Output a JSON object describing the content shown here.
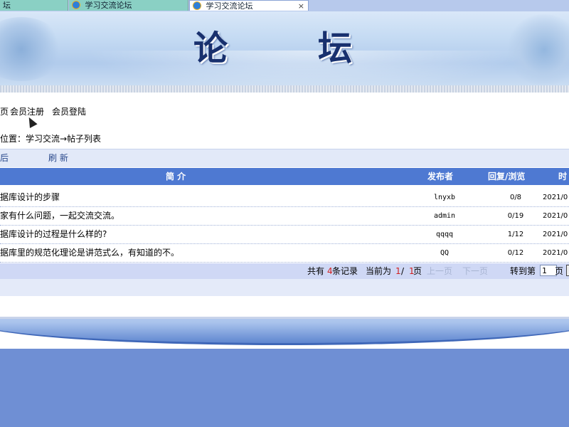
{
  "browser": {
    "tabs": [
      {
        "label": "坛",
        "active": false
      },
      {
        "label": "学习交流论坛",
        "active": false
      },
      {
        "label": "学习交流论坛",
        "active": true
      }
    ],
    "close_glyph": "×"
  },
  "banner": {
    "title_char1": "论",
    "title_char2": "坛"
  },
  "nav": {
    "home_partial": "页",
    "register": "会员注册",
    "login": "会员登陆"
  },
  "breadcrumb": "位置：学习交流→帖子列表",
  "toolbar": {
    "post_partial": "后",
    "refresh": "刷  新"
  },
  "table": {
    "headers": {
      "title": "简   介",
      "author": "发布者",
      "reply_view": "回复/浏览",
      "time_partial": "时"
    },
    "rows": [
      {
        "title": "据库设计的步骤",
        "author": "lnyxb",
        "reply_view": "0/8",
        "time": "2021/0"
      },
      {
        "title": "家有什么问题，一起交流交流。",
        "author": "admin",
        "reply_view": "0/19",
        "time": "2021/0"
      },
      {
        "title": "据库设计的过程是什么样的?",
        "author": "qqqq",
        "reply_view": "1/12",
        "time": "2021/0"
      },
      {
        "title": "据库里的规范化理论是讲范式么，有知道的不。",
        "author": "QQ",
        "reply_view": "0/12",
        "time": "2021/0"
      }
    ]
  },
  "pager": {
    "total_prefix": "共有",
    "total_count": "4",
    "total_suffix": "条记录",
    "current_prefix": "当前为",
    "current_page": "1",
    "slash": "/",
    "total_pages": "1",
    "page_suffix": "页",
    "prev": "上一页",
    "next": "下一页",
    "goto_prefix": "转到第",
    "goto_value": "1",
    "goto_suffix": "页"
  },
  "colors": {
    "header_blue": "#4e79d2",
    "pager_bg": "#cfd8f5",
    "highlight_red": "#d02020",
    "page_bg": "#6f8fd4"
  }
}
